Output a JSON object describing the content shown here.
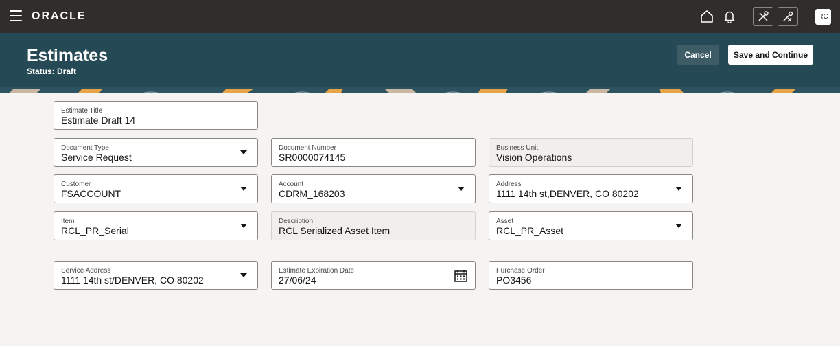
{
  "topbar": {
    "brand": "ORACLE",
    "avatar_initials": "RC",
    "icons": [
      "menu-icon",
      "home-icon",
      "bell-icon",
      "tech-icon",
      "tech-off-icon"
    ]
  },
  "header": {
    "title": "Estimates",
    "status": "Status: Draft",
    "cancel_label": "Cancel",
    "save_label": "Save and Continue"
  },
  "form": {
    "estimate_title": {
      "label": "Estimate Title",
      "value": "Estimate Draft 14"
    },
    "document_type": {
      "label": "Document Type",
      "value": "Service Request"
    },
    "document_number": {
      "label": "Document Number",
      "value": "SR0000074145"
    },
    "business_unit": {
      "label": "Business Unit",
      "value": "Vision Operations"
    },
    "customer": {
      "label": "Customer",
      "value": "FSACCOUNT"
    },
    "account": {
      "label": "Account",
      "value": "CDRM_168203"
    },
    "address": {
      "label": "Address",
      "value": "1111 14th st,DENVER, CO 80202"
    },
    "item": {
      "label": "Item",
      "value": "RCL_PR_Serial"
    },
    "description": {
      "label": "Description",
      "value": "RCL Serialized Asset Item"
    },
    "asset": {
      "label": "Asset",
      "value": "RCL_PR_Asset"
    },
    "service_address": {
      "label": "Service Address",
      "value": "1111 14th st/DENVER, CO 80202"
    },
    "expiration_date": {
      "label": "Estimate Expiration Date",
      "value": "27/06/24"
    },
    "purchase_order": {
      "label": "Purchase Order",
      "value": "PO3456"
    }
  },
  "colors": {
    "topbar": "#312d2a",
    "header": "#254a55",
    "background": "#f5f4f2"
  }
}
